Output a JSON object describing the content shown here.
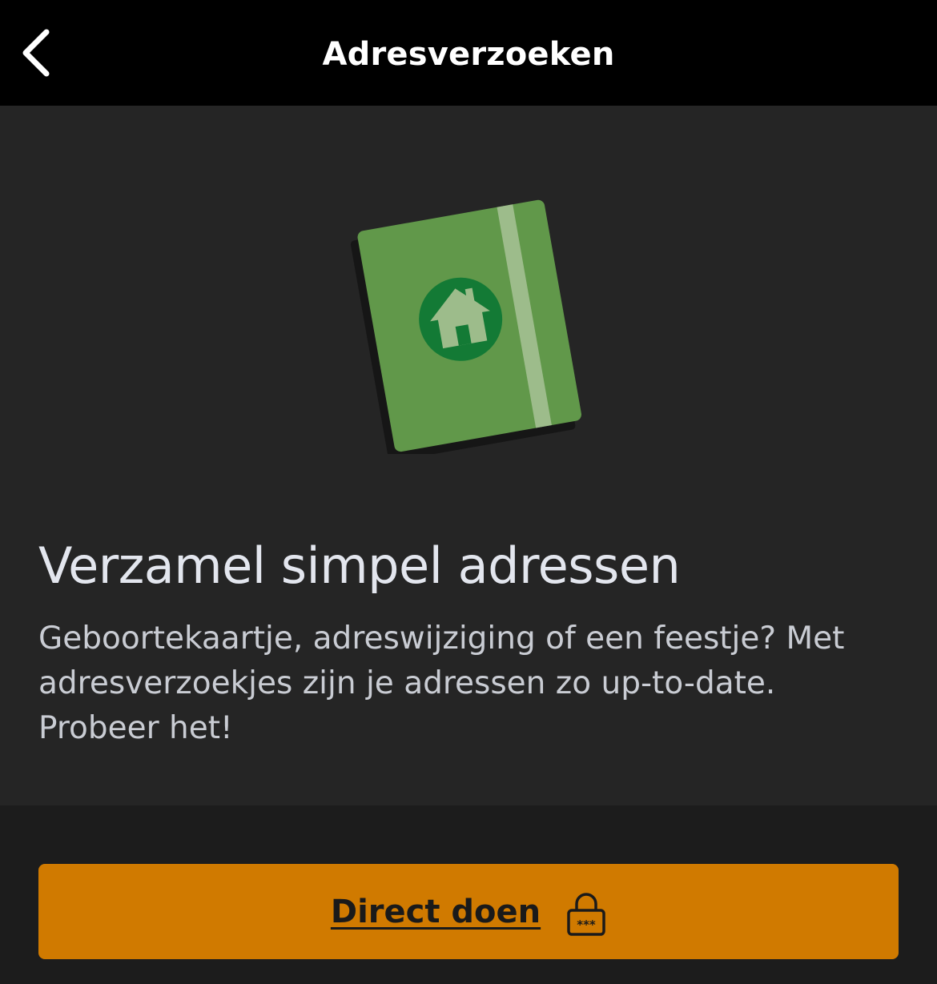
{
  "header": {
    "title": "Adresverzoeken",
    "back_icon": "chevron-left-icon"
  },
  "hero": {
    "illustration": "address-book-house-icon",
    "colors": {
      "book": "#61984a",
      "book_shadow": "#161616",
      "band": "#9dbc8b",
      "badge": "#137a35",
      "house": "#9dbc8b"
    }
  },
  "main": {
    "title": "Verzamel simpel adressen",
    "description": "Geboortekaartje, adreswijziging of een feestje? Met adresverzoekjes zijn je adressen zo up-to-date. Probeer het!"
  },
  "cta": {
    "label": "Direct doen",
    "icon": "lock-password-icon",
    "color": "#d07a00"
  }
}
